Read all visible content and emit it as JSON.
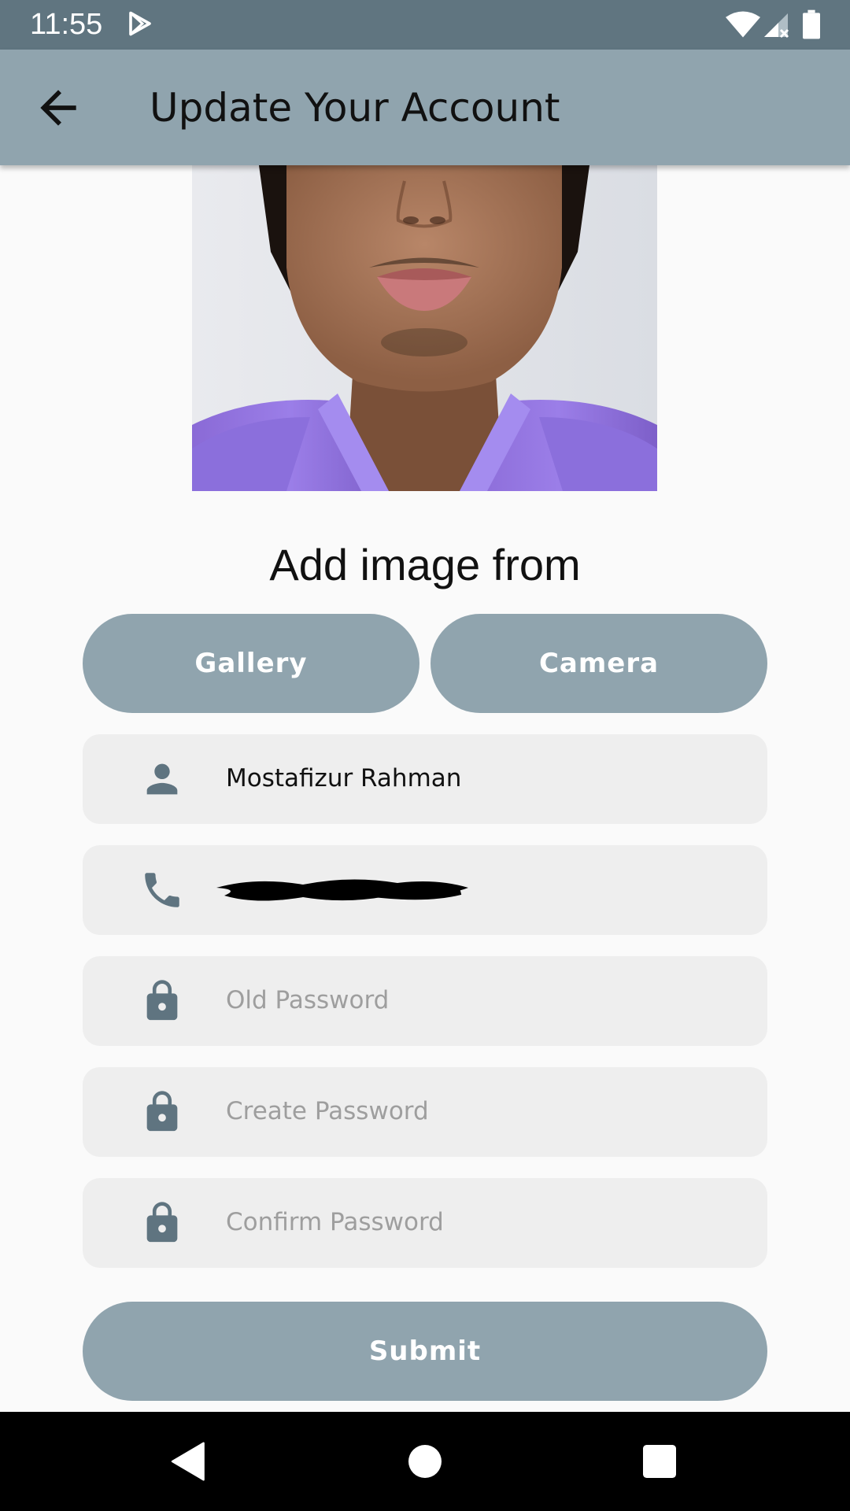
{
  "status_bar": {
    "time": "11:55",
    "icons": [
      "play-store-icon",
      "wifi-icon",
      "signal-icon",
      "battery-icon"
    ]
  },
  "app_bar": {
    "title": "Update Your Account",
    "back_icon": "arrow-back-icon"
  },
  "image_section": {
    "heading": "Add image from",
    "gallery_label": "Gallery",
    "camera_label": "Camera"
  },
  "form": {
    "name_value": "Mostafizur Rahman",
    "phone_value": "",
    "old_password_placeholder": "Old Password",
    "create_password_placeholder": "Create Password",
    "confirm_password_placeholder": "Confirm Password",
    "submit_label": "Submit"
  },
  "colors": {
    "accent": "#90a4ae",
    "status_bar": "#607580",
    "field_bg": "#eeeeee",
    "icon": "#5f7480"
  }
}
